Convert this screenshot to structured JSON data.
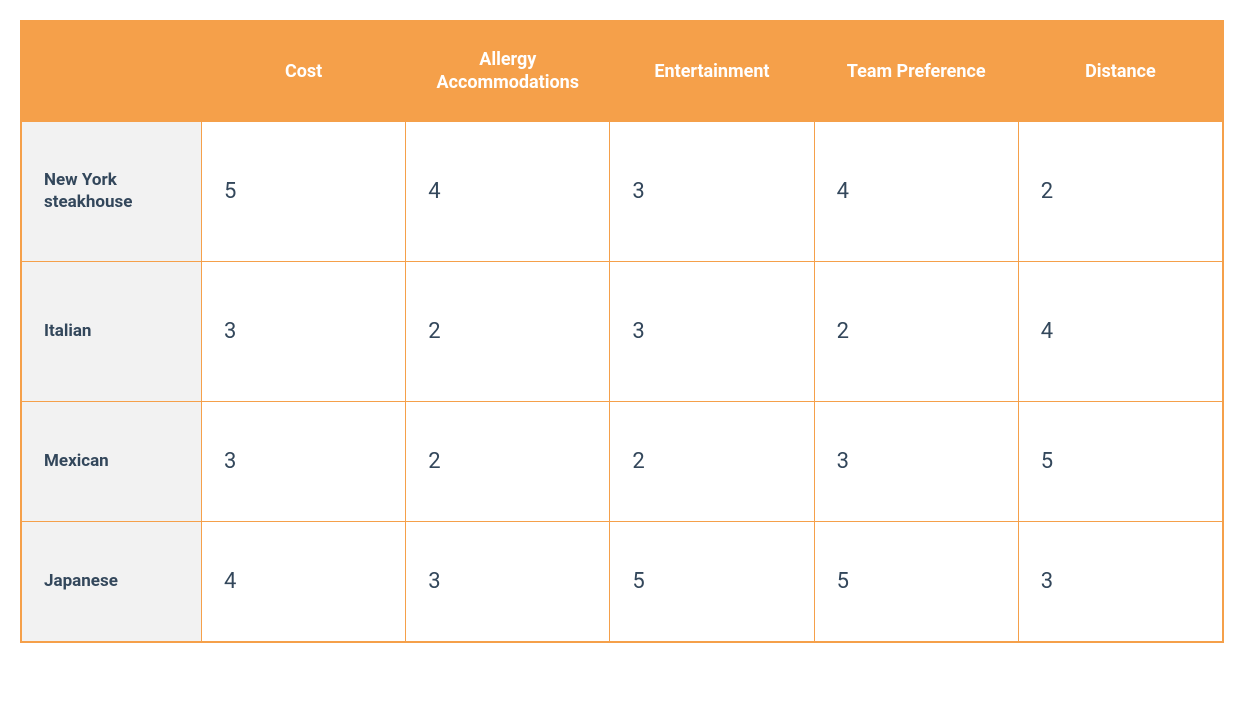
{
  "chart_data": {
    "type": "table",
    "columns": [
      "Cost",
      "Allergy Accommodations",
      "Entertainment",
      "Team Preference",
      "Distance"
    ],
    "rows": [
      {
        "label": "New York steakhouse",
        "values": [
          5,
          4,
          3,
          4,
          2
        ]
      },
      {
        "label": "Italian",
        "values": [
          3,
          2,
          3,
          2,
          4
        ]
      },
      {
        "label": "Mexican",
        "values": [
          3,
          2,
          2,
          3,
          5
        ]
      },
      {
        "label": "Japanese",
        "values": [
          4,
          3,
          5,
          5,
          3
        ]
      }
    ]
  }
}
